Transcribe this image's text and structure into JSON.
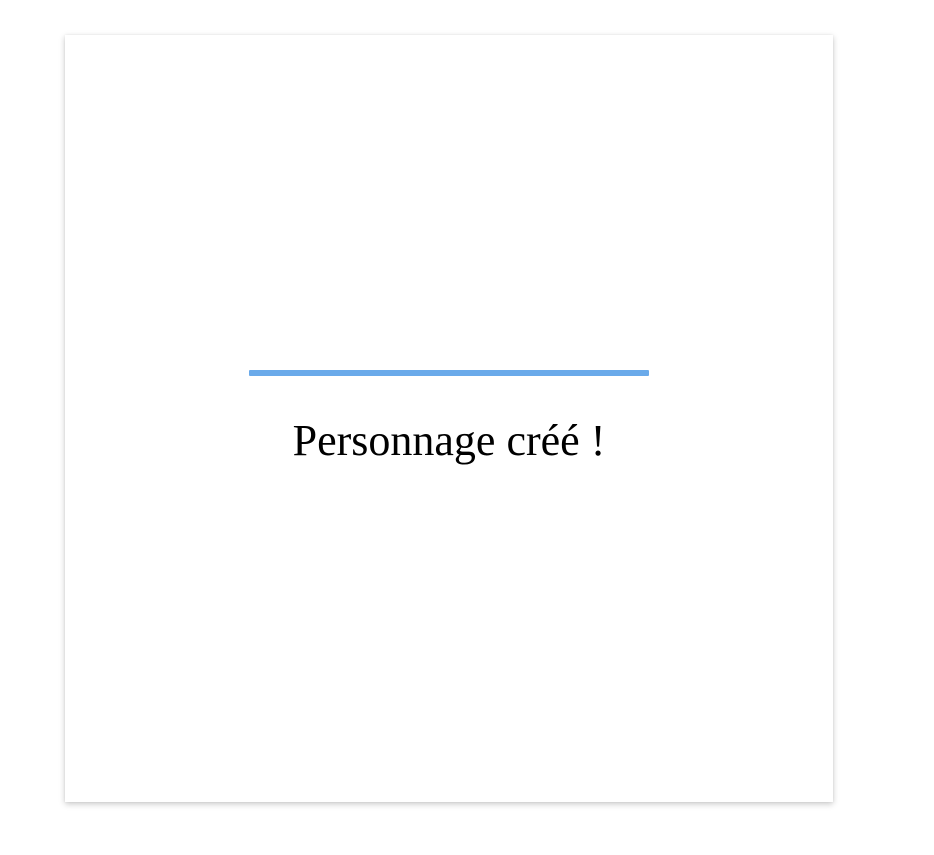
{
  "dialog": {
    "message": "Personnage créé !",
    "progress": {
      "percent": 100,
      "color": "#6aaaea"
    }
  }
}
